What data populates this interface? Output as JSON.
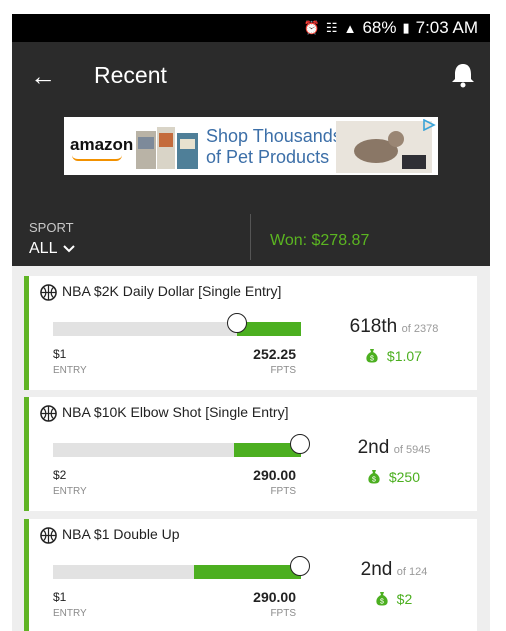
{
  "status_bar": {
    "battery": "68%",
    "time": "7:03 AM"
  },
  "header": {
    "title": "Recent"
  },
  "ad": {
    "brand": "amazon",
    "line1": "Shop Thousands",
    "line2": "of Pet Products"
  },
  "filters": {
    "sport_label": "SPORT",
    "sport_value": "ALL",
    "won_text": "Won: $278.87"
  },
  "colors": {
    "accent_green": "#5bb521",
    "header_bg": "#2b2b2b",
    "status_bg": "#000000"
  },
  "contests": [
    {
      "title": "NBA $2K Daily Dollar [Single Entry]",
      "entry_value": "$1",
      "entry_label": "ENTRY",
      "fpts_value": "252.25",
      "fpts_label": "FPTS",
      "rank": "618th",
      "of_text": "of 2378",
      "prize": "$1.07",
      "progress": 0.74
    },
    {
      "title": "NBA $10K Elbow Shot [Single Entry]",
      "entry_value": "$2",
      "entry_label": "ENTRY",
      "fpts_value": "290.00",
      "fpts_label": "FPTS",
      "rank": "2nd",
      "of_text": "of 5945",
      "prize": "$250",
      "progress": 0.995
    },
    {
      "title": "NBA $1 Double Up",
      "entry_value": "$1",
      "entry_label": "ENTRY",
      "fpts_value": "290.00",
      "fpts_label": "FPTS",
      "rank": "2nd",
      "of_text": "of 124",
      "prize": "$2",
      "progress": 0.995
    }
  ]
}
